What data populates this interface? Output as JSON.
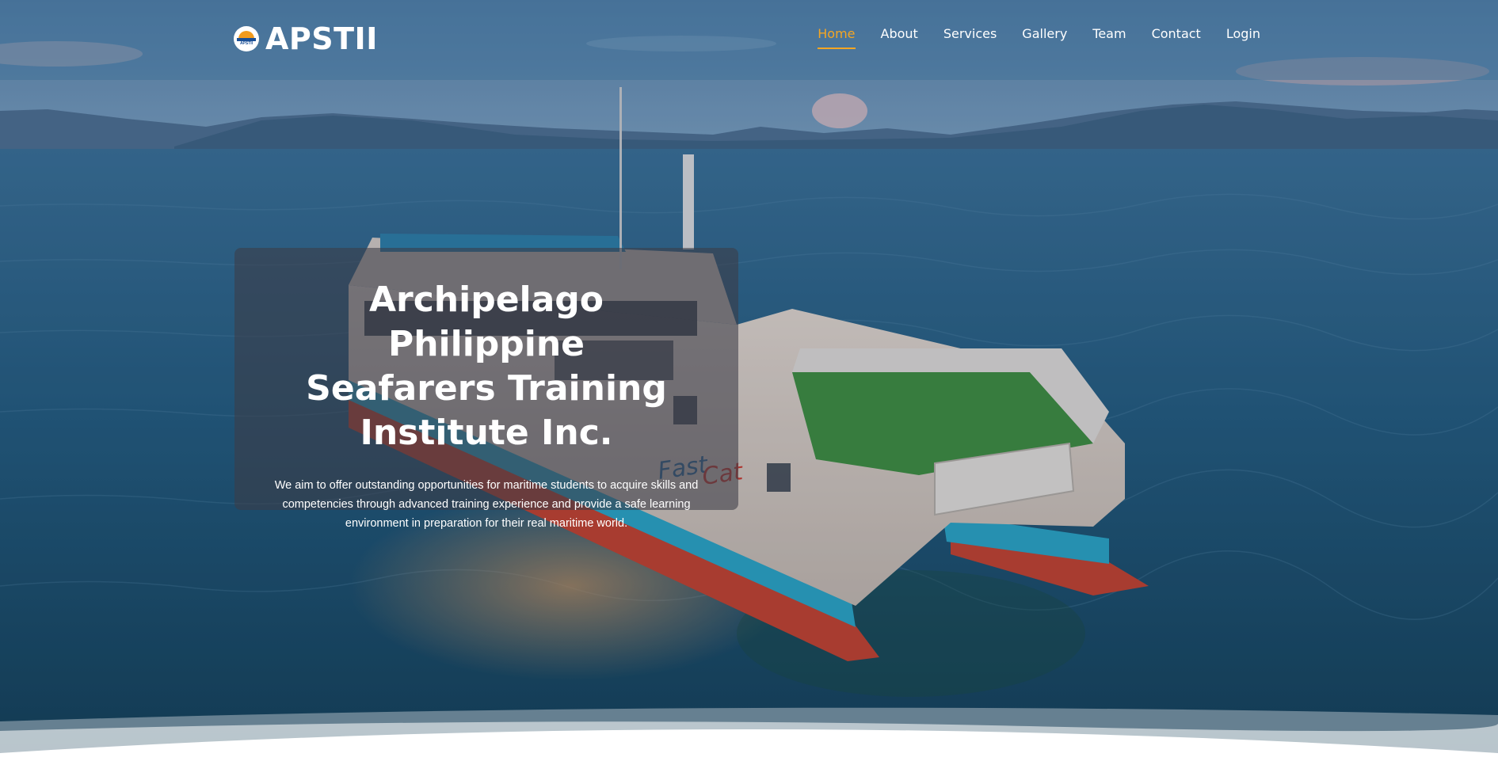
{
  "brand": {
    "name": "APSTII",
    "logo_text": "APSTII",
    "logo_icon": "apstii-logo-icon"
  },
  "nav": {
    "items": [
      {
        "label": "Home",
        "active": true
      },
      {
        "label": "About",
        "active": false
      },
      {
        "label": "Services",
        "active": false
      },
      {
        "label": "Gallery",
        "active": false
      },
      {
        "label": "Team",
        "active": false
      },
      {
        "label": "Contact",
        "active": false
      },
      {
        "label": "Login",
        "active": false
      }
    ]
  },
  "hero": {
    "title": "Archipelago Philippine\nSeafarers Training\nInstitute Inc.",
    "description": "We aim to offer outstanding opportunities for maritime students to acquire skills and\ncompetencies through advanced training experience and provide a safe learning\nenvironment in preparation for their real maritime world.",
    "ship_hull_text": "FastCat"
  },
  "colors": {
    "accent": "#f5a623",
    "sea": "#1f5f82",
    "sky": "#5d8fb5",
    "card": "#3c3c46"
  }
}
